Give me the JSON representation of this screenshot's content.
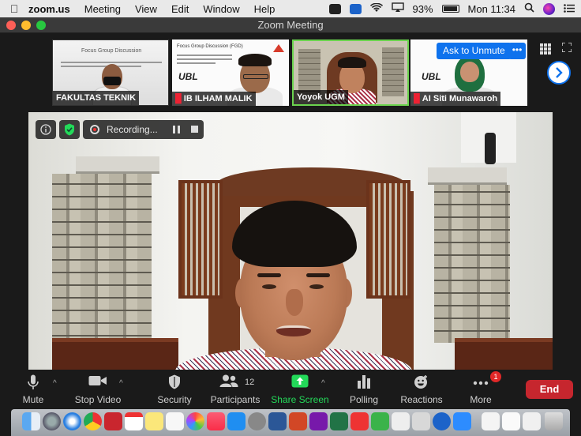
{
  "menubar": {
    "app_name": "zoom.us",
    "items": [
      "Meeting",
      "View",
      "Edit",
      "Window",
      "Help"
    ],
    "battery": "93%",
    "clock": "Mon 11:34"
  },
  "window": {
    "title": "Zoom Meeting"
  },
  "gallery": {
    "participants": [
      {
        "name": "FAKULTAS TEKNIK",
        "muted": false
      },
      {
        "name": "IB ILHAM MALIK",
        "muted": true
      },
      {
        "name": "Yoyok UGM",
        "muted": false,
        "speaking": true
      },
      {
        "name": "AI Siti Munawaroh",
        "muted": true
      }
    ],
    "slide_text": "Focus Group Discussion",
    "slide_text_2": "Focus Group Discussion (FGD)",
    "logo_text": "UBL",
    "ask_to_unmute_label": "Ask to Unmute",
    "more_label": "•••"
  },
  "recording": {
    "label": "Recording..."
  },
  "toolbar": {
    "mute_label": "Mute",
    "stop_video_label": "Stop Video",
    "security_label": "Security",
    "participants_label": "Participants",
    "participants_count": "12",
    "share_screen_label": "Share Screen",
    "polling_label": "Polling",
    "reactions_label": "Reactions",
    "more_label": "More",
    "more_badge": "1",
    "end_label": "End"
  },
  "colors": {
    "accent": "#0e72ed",
    "share_green": "#23d959",
    "end_red": "#c6262e",
    "active_speaker": "#6bd34e"
  }
}
